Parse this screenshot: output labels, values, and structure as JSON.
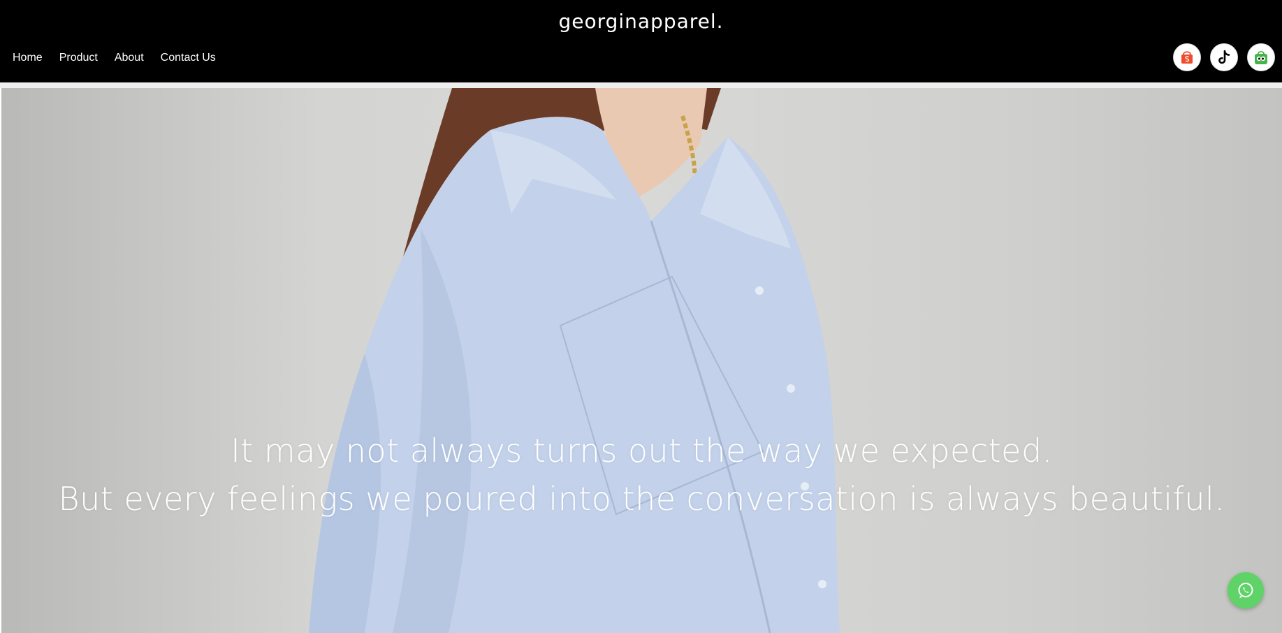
{
  "header": {
    "brand": "georginapparel.",
    "nav": [
      {
        "label": "Home"
      },
      {
        "label": "Product"
      },
      {
        "label": "About"
      },
      {
        "label": "Contact Us"
      }
    ],
    "socials": [
      {
        "icon": "shopee-icon",
        "color": "#ee4d2d"
      },
      {
        "icon": "tiktok-icon",
        "color": "#000000"
      },
      {
        "icon": "tokopedia-icon",
        "color": "#42b549"
      }
    ]
  },
  "hero": {
    "line1": "It may not always turns out the way we expected.",
    "line2": "But every feelings we poured into the conversation is always beautiful."
  },
  "floating": {
    "whatsapp_icon": "whatsapp-icon",
    "whatsapp_color": "#5fd268"
  }
}
